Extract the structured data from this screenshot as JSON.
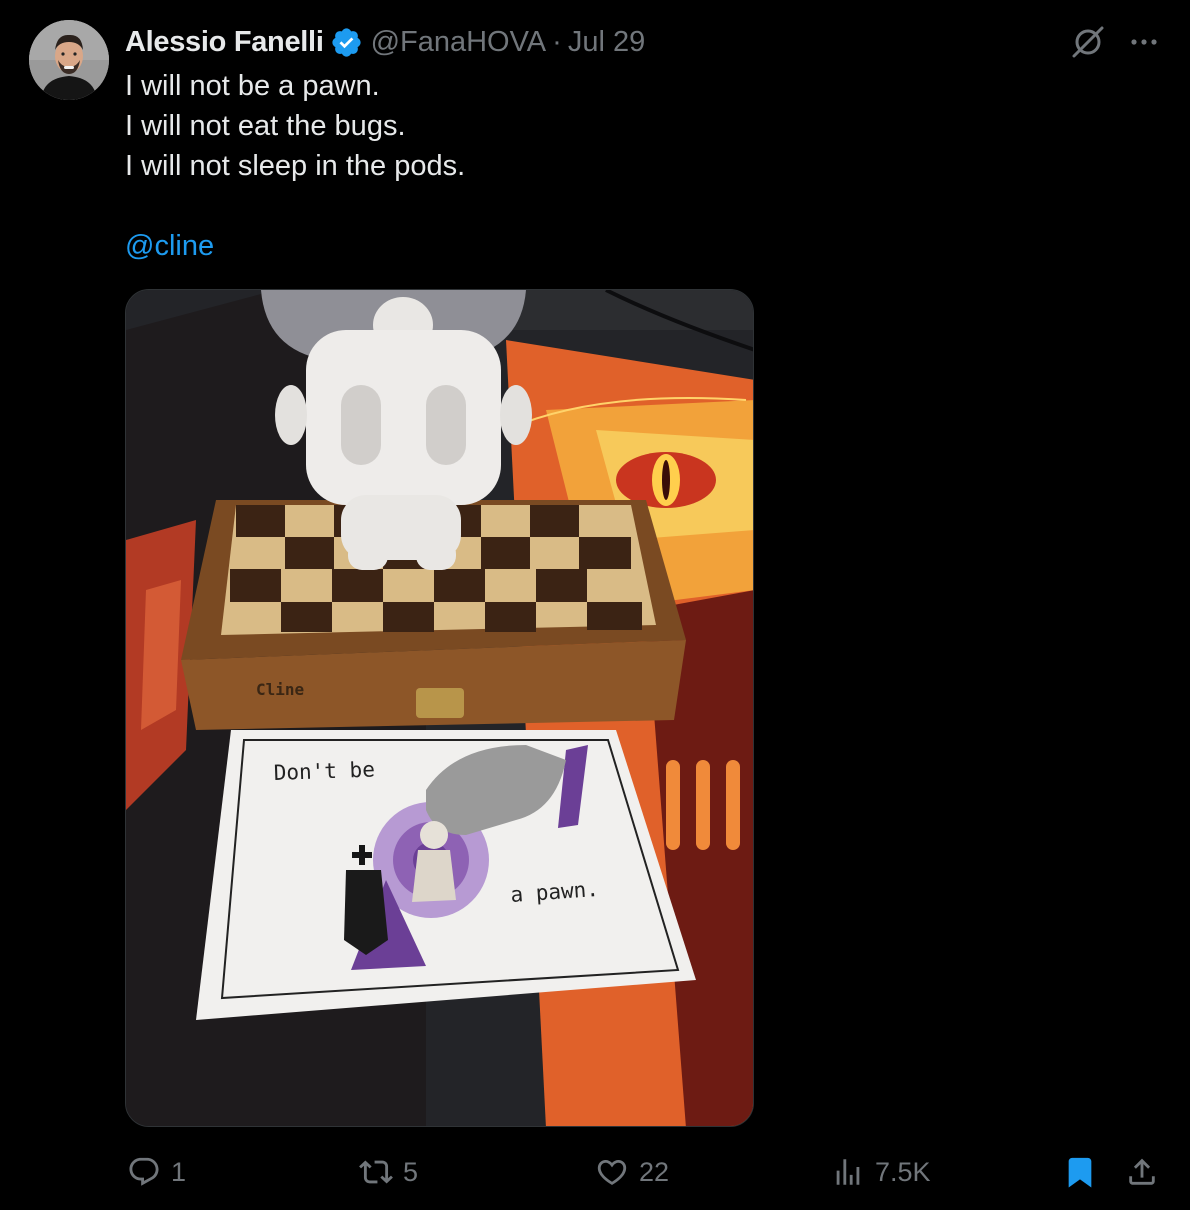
{
  "tweet": {
    "author_name": "Alessio Fanelli",
    "handle": "@FanaHOVA",
    "separator": "·",
    "date": "Jul 29",
    "lines": [
      "I will not be a pawn.",
      "I will not eat the bugs.",
      "I will not sleep in the pods."
    ],
    "mention": "@cline"
  },
  "media": {
    "box_brand": "Cline",
    "card_text_top": "Don't be",
    "card_text_bottom": "a pawn."
  },
  "actions": {
    "reply_count": "1",
    "repost_count": "5",
    "like_count": "22",
    "views_count": "7.5K",
    "bookmarked": true
  },
  "colors": {
    "background": "#000000",
    "text": "#e7e9ea",
    "muted": "#71767b",
    "link": "#1d9bf0",
    "verified": "#1d9bf0"
  },
  "icons": [
    "verified-badge-icon",
    "grok-icon",
    "more-icon",
    "reply-icon",
    "repost-icon",
    "like-icon",
    "views-icon",
    "bookmark-icon",
    "share-icon"
  ]
}
